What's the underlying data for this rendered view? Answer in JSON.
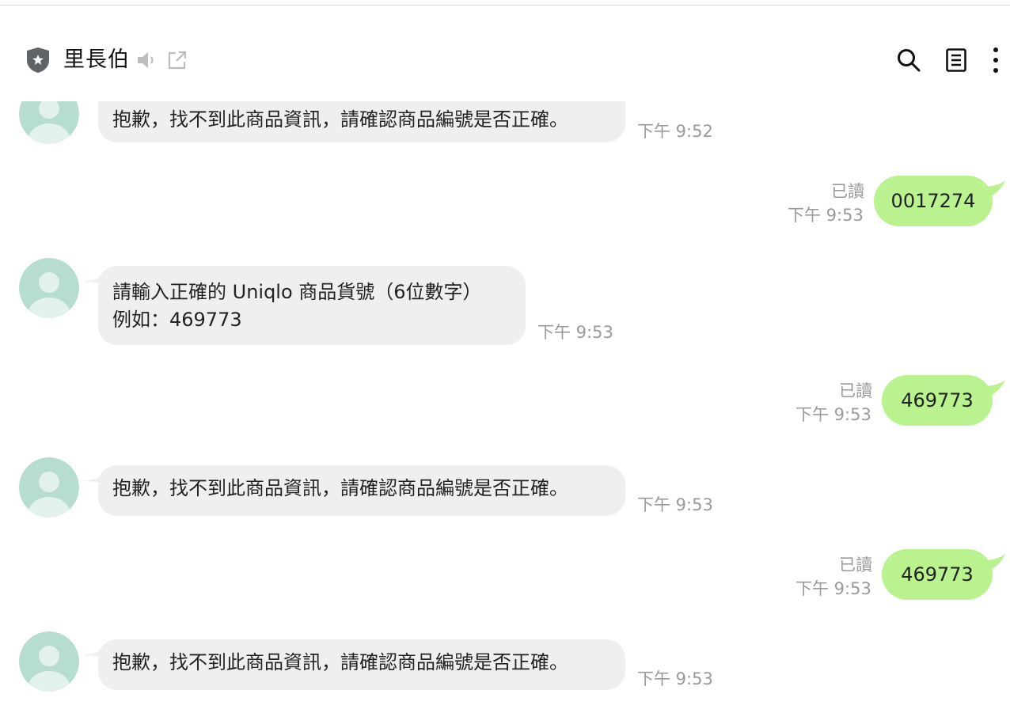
{
  "header": {
    "title": "里長伯",
    "icons": [
      "shield-icon",
      "mute-icon",
      "external-link-icon",
      "search-icon",
      "notes-icon",
      "more-icon"
    ]
  },
  "colors": {
    "incoming_bubble": "#efefef",
    "outgoing_bubble": "#b9f28f",
    "avatar": "#b7ddd0",
    "timestamp": "#9a9a9a"
  },
  "messages": [
    {
      "sender": "bot",
      "lines": [
        "抱歉，找不到此商品資訊，請確認商品編號是否正確。"
      ],
      "time": "下午 9:52"
    },
    {
      "sender": "me",
      "text": "0017274",
      "status": "已讀",
      "time": "下午 9:53"
    },
    {
      "sender": "bot",
      "lines": [
        "請輸入正確的 Uniqlo 商品貨號（6位數字）",
        "例如：469773"
      ],
      "time": "下午 9:53"
    },
    {
      "sender": "me",
      "text": "469773",
      "status": "已讀",
      "time": "下午 9:53"
    },
    {
      "sender": "bot",
      "lines": [
        "抱歉，找不到此商品資訊，請確認商品編號是否正確。"
      ],
      "time": "下午 9:53"
    },
    {
      "sender": "me",
      "text": "469773",
      "status": "已讀",
      "time": "下午 9:53"
    },
    {
      "sender": "bot",
      "lines": [
        "抱歉，找不到此商品資訊，請確認商品編號是否正確。"
      ],
      "time": "下午 9:53"
    }
  ]
}
